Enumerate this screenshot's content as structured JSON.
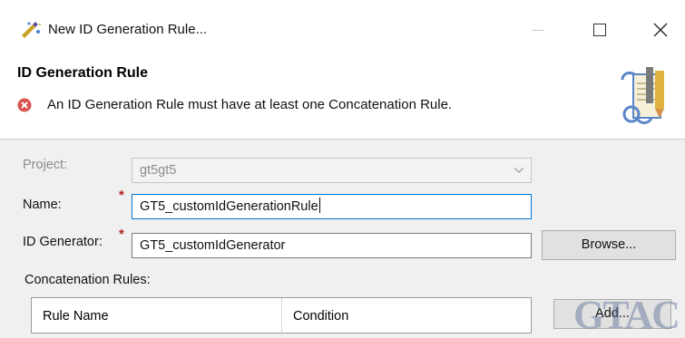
{
  "window": {
    "title": "New ID Generation Rule...",
    "controls": [
      "minimize",
      "maximize",
      "close"
    ]
  },
  "header": {
    "title": "ID Generation Rule",
    "error_message": "An ID Generation Rule must have at least one Concatenation Rule.",
    "error_icon": "error-icon",
    "graphic_icon": "wizard-scroll-icon"
  },
  "form": {
    "project": {
      "label": "Project:",
      "value": "gt5gt5",
      "disabled": true
    },
    "name": {
      "label": "Name:",
      "required_marker": "*",
      "value": "GT5_customIdGenerationRule"
    },
    "id_generator": {
      "label": "ID Generator:",
      "required_marker": "*",
      "value": "GT5_customIdGenerator",
      "browse_label": "Browse..."
    },
    "concatenation_rules": {
      "label": "Concatenation Rules:",
      "columns": [
        "Rule Name",
        "Condition"
      ],
      "add_label": "Add..."
    }
  },
  "watermark": "GTAC",
  "colors": {
    "error": "#d9534f",
    "focus_border": "#0078d7",
    "required": "#b22222"
  }
}
